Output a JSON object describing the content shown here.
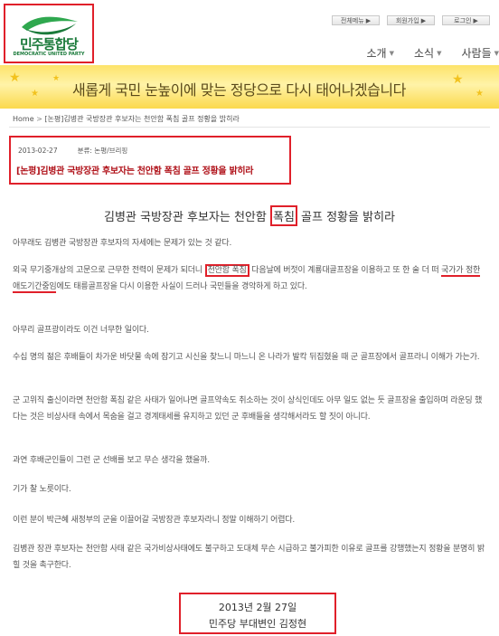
{
  "logo": {
    "name": "민주통합당",
    "sub": "DEMOCRATIC UNITED PARTY"
  },
  "top_links": [
    {
      "label": "전체메뉴"
    },
    {
      "label": "회원가입"
    },
    {
      "label": "로그인"
    }
  ],
  "gnb": [
    {
      "label": "소개"
    },
    {
      "label": "소식"
    },
    {
      "label": "사람들"
    }
  ],
  "banner": {
    "slogan": "새롭게 국민 눈높이에 맞는 정당으로 다시 태어나겠습니다"
  },
  "breadcrumb": {
    "home": "Home",
    "current": "[논평]김병관 국방장관 후보자는 천안함 폭침 골프 정황을 밝히라"
  },
  "meta": {
    "date": "2013-02-27",
    "category": "분류: 논평/브리핑",
    "title": "[논평]김병관 국방장관 후보자는 천안함 폭침 골프 정황을 밝히라"
  },
  "article": {
    "title_before": "김병관 국방장관 후보자는 천안함 ",
    "title_highlight": "폭침",
    "title_after": " 골프 정황을 밝히라",
    "p1": "아무래도 김병관 국방장관 후보자의 자세에는 문제가 있는 것 같다.",
    "p2_a": "외국 무기중개상의 고문으로 근무한 전력이 문제가 되더니 ",
    "p2_boxed": "천안함 폭침",
    "p2_b": " 다음날에 버젓이 계룡대골프장을 이용하고 또 한 술 더 떠 ",
    "p2_underlined": "국가가 정한 애도기간중임",
    "p2_c": "에도 태릉골프장을 다시 이용한 사실이 드러나 국민들을 경악하게 하고 있다.",
    "p3": "아무리 골프광이라도 이건 너무한 일이다.",
    "p4": "수십 명의 젊은 후배들이 차가운 바닷물 속에 잠기고 시신을 찾느니 마느니 온 나라가 발칵 뒤집혔을 때 군 골프장에서 골프라니 이해가 가는가.",
    "p5": "군 고위직 출신이라면 천안함 폭침 같은 사태가 일어나면 골프약속도 취소하는 것이 상식인데도 아무 일도 없는 듯 골프장을 출입하며 라운딩 했다는 것은 비상사태 속에서 목숨을 걸고 경계태세를 유지하고 있던 군 후배들을 생각해서라도 할 짓이 아니다.",
    "p6": "과연 후배군인들이 그런 군 선배를 보고 무슨 생각을 했을까.",
    "p7": "기가 찰 노릇이다.",
    "p8": "이런 분이 박근혜 새정부의 군을 이끌어갈 국방장관 후보자라니 정말 이해하기 어렵다.",
    "p9": "김병관 장관 후보자는 천안함 사태 같은 국가비상사태에도 불구하고 도대체 무슨 시급하고 불가피한 이유로 골프를 강행했는지 정황을 분명히 밝힐 것을 촉구한다."
  },
  "signature": {
    "date": "2013년 2월 27일",
    "name": "민주당 부대변인 김정현"
  },
  "colors": {
    "highlight_border": "#e0202a",
    "logo_green": "#1a7a3a",
    "banner_yellow": "#fde36a"
  }
}
